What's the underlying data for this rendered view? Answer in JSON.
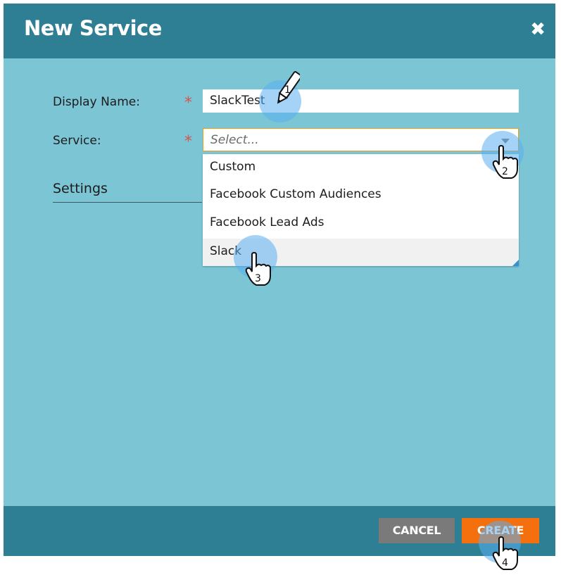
{
  "dialog": {
    "title": "New Service",
    "close_icon": "close-icon"
  },
  "form": {
    "display_name_label": "Display Name:",
    "display_name_value": "SlackTest",
    "service_label": "Service:",
    "service_placeholder": "Select...",
    "required_mark": "*",
    "settings_heading": "Settings"
  },
  "dropdown": {
    "options": [
      "Custom",
      "Facebook Custom Audiences",
      "Facebook Lead Ads",
      "Slack"
    ],
    "highlighted": "Slack"
  },
  "footer": {
    "cancel_label": "CANCEL",
    "create_label": "CREATE"
  },
  "callouts": [
    "1",
    "2",
    "3",
    "4"
  ],
  "colors": {
    "header": "#2e7f93",
    "body": "#7bc5d5",
    "required": "#d9534f",
    "create_button": "#f4700f",
    "cancel_button": "#7a7a7a"
  }
}
